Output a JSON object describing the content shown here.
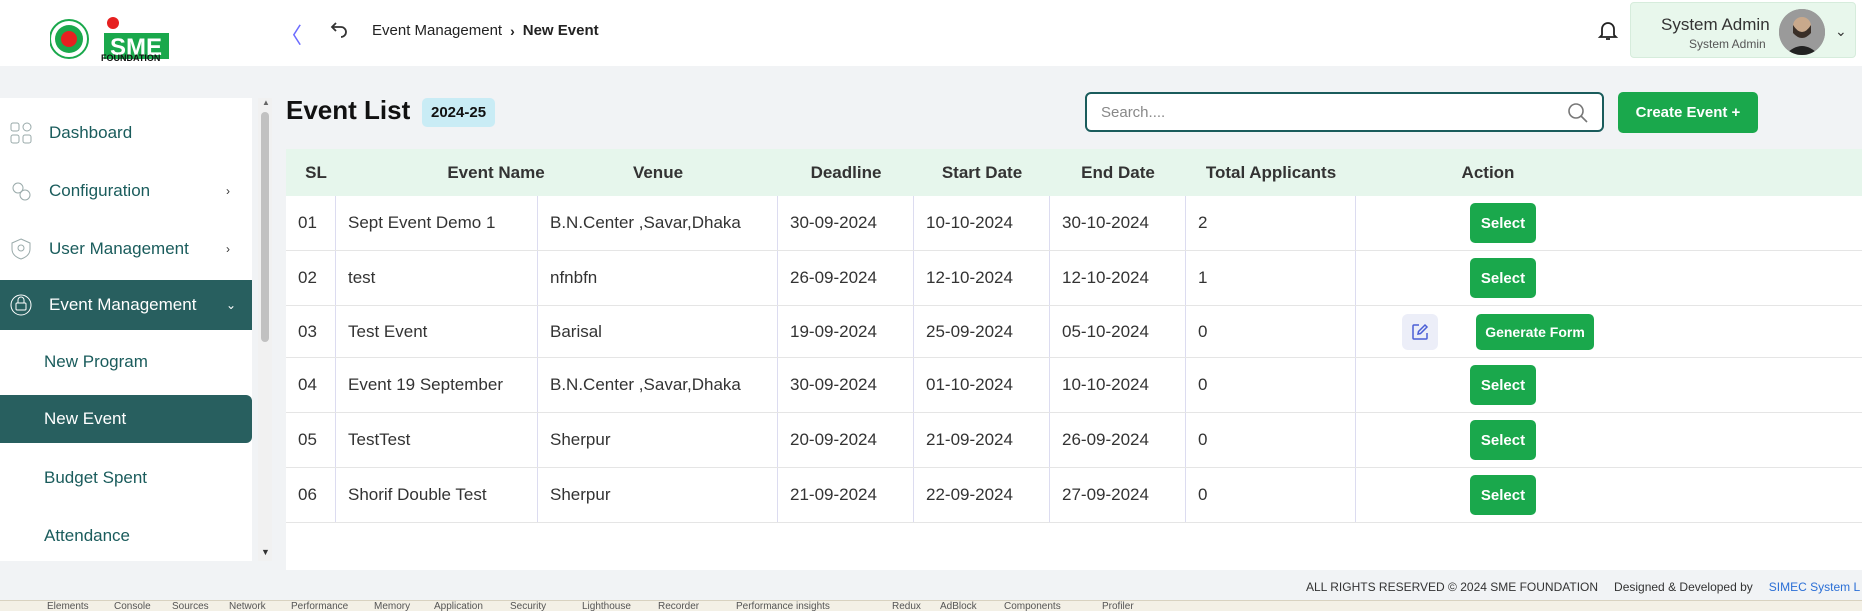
{
  "brand": {
    "logo_text": "SME",
    "logo_subtext": "FOUNDATION",
    "colors": {
      "green": "#1aa84c",
      "teal": "#285f5f",
      "red": "#e62020"
    }
  },
  "header": {
    "breadcrumb_parent": "Event Management",
    "breadcrumb_current": "New Event",
    "user_name": "System Admin",
    "user_role": "System Admin"
  },
  "sidebar": {
    "items": [
      {
        "label": "Dashboard",
        "icon": "grid-icon",
        "has_arrow": false
      },
      {
        "label": "Configuration",
        "icon": "gears-icon",
        "has_arrow": true
      },
      {
        "label": "User Management",
        "icon": "shield-user-icon",
        "has_arrow": true
      },
      {
        "label": "Event Management",
        "icon": "event-icon",
        "has_arrow": true,
        "active": true
      }
    ],
    "subitems": [
      {
        "label": "New Program"
      },
      {
        "label": "New Event",
        "active": true
      },
      {
        "label": "Budget Spent"
      },
      {
        "label": "Attendance"
      }
    ]
  },
  "main": {
    "title": "Event List",
    "year_badge": "2024-25",
    "search_placeholder": "Search....",
    "create_label": "Create Event +"
  },
  "table": {
    "columns": [
      "SL",
      "Event Name",
      "Venue",
      "Deadline",
      "Start Date",
      "End Date",
      "Total Applicants",
      "Action"
    ],
    "rows": [
      {
        "sl": "01",
        "name": "Sept Event Demo 1",
        "venue": "B.N.Center ,Savar,Dhaka",
        "deadline": "30-09-2024",
        "start": "10-10-2024",
        "end": "30-10-2024",
        "applicants": "2",
        "action": "Select"
      },
      {
        "sl": "02",
        "name": "test",
        "venue": "nfnbfn",
        "deadline": "26-09-2024",
        "start": "12-10-2024",
        "end": "12-10-2024",
        "applicants": "1",
        "action": "Select"
      },
      {
        "sl": "03",
        "name": "Test Event",
        "venue": "Barisal",
        "deadline": "19-09-2024",
        "start": "25-09-2024",
        "end": "05-10-2024",
        "applicants": "0",
        "action": "Generate Form"
      },
      {
        "sl": "04",
        "name": "Event 19 September",
        "venue": "B.N.Center ,Savar,Dhaka",
        "deadline": "30-09-2024",
        "start": "01-10-2024",
        "end": "10-10-2024",
        "applicants": "0",
        "action": "Select"
      },
      {
        "sl": "05",
        "name": "TestTest",
        "venue": "Sherpur",
        "deadline": "20-09-2024",
        "start": "21-09-2024",
        "end": "26-09-2024",
        "applicants": "0",
        "action": "Select"
      },
      {
        "sl": "06",
        "name": "Shorif Double Test",
        "venue": "Sherpur",
        "deadline": "21-09-2024",
        "start": "22-09-2024",
        "end": "27-09-2024",
        "applicants": "0",
        "action": "Select"
      }
    ]
  },
  "footer": {
    "rights": "ALL RIGHTS RESERVED © 2024 SME FOUNDATION",
    "designed": "Designed & Developed by",
    "company": "SIMEC System L"
  },
  "devtools_tabs": [
    "Elements",
    "Console",
    "Sources",
    "Network",
    "Performance",
    "Memory",
    "Application",
    "Security",
    "Lighthouse",
    "Recorder",
    "Performance insights",
    "Redux",
    "AdBlock",
    "Components",
    "Profiler"
  ]
}
